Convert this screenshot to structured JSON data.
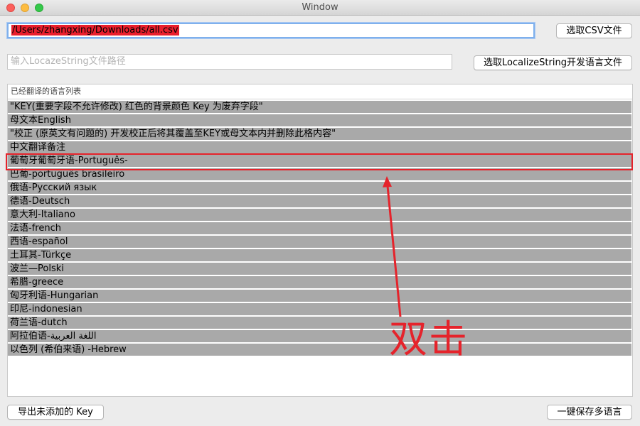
{
  "window": {
    "title": "Window"
  },
  "csv": {
    "path": "/Users/zhangxing/Downloads/all.csv",
    "button_label": "选取CSV文件"
  },
  "localize": {
    "placeholder": "输入LocazeString文件路径",
    "button_label": "选取LocalizeString开发语言文件"
  },
  "table": {
    "header": "已经翻译的语言列表",
    "rows": [
      "\"KEY(重要字段不允许修改) 红色的背景颜色 Key 为废弃字段\"",
      "母文本English",
      "\"校正 (原英文有问题的) 开发校正后将其覆盖至KEY或母文本内并删除此格内容\"",
      "中文翻译备注",
      "葡萄牙葡萄牙语-Português-",
      "巴葡-português brasileiro",
      "俄语-Русский язык",
      "德语-Deutsch",
      "意大利-Italiano",
      "法语-french",
      "西语-español",
      "土耳其-Türkçe",
      "波兰—Polski",
      "希腊-greece",
      "匈牙利语-Hungarian",
      "印尼-indonesian",
      "荷兰语-dutch",
      "阿拉伯语-اللغة العربية",
      "以色列 (希伯来语) -Hebrew"
    ],
    "highlighted_row_index": 4
  },
  "annotation": {
    "label": "双击",
    "color": "#e5232b"
  },
  "footer": {
    "export_label": "导出未添加的 Key",
    "save_label": "一键保存多语言"
  }
}
